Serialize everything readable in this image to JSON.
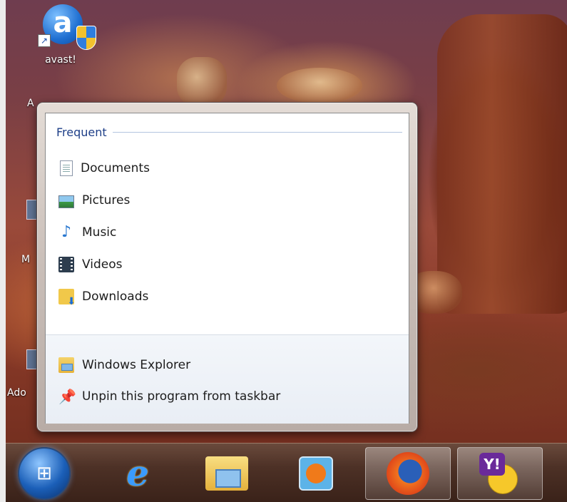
{
  "desktop": {
    "icon_label": "avast!",
    "side_fragments": [
      "A",
      "M",
      "Ado"
    ]
  },
  "jumplist": {
    "section_title": "Frequent",
    "frequent_items": [
      {
        "label": "Documents",
        "icon": "documents-icon"
      },
      {
        "label": "Pictures",
        "icon": "pictures-icon"
      },
      {
        "label": "Music",
        "icon": "music-icon"
      },
      {
        "label": "Videos",
        "icon": "videos-icon"
      },
      {
        "label": "Downloads",
        "icon": "downloads-icon"
      }
    ],
    "tasks": [
      {
        "label": "Windows Explorer",
        "icon": "windows-explorer-icon"
      },
      {
        "label": "Unpin this program from taskbar",
        "icon": "unpin-icon"
      }
    ]
  },
  "taskbar": {
    "buttons": [
      "start-orb-icon",
      "internet-explorer-icon",
      "windows-explorer-icon",
      "windows-media-player-icon",
      "firefox-icon",
      "yahoo-messenger-icon"
    ],
    "active": [
      "firefox-icon",
      "yahoo-messenger-icon"
    ]
  },
  "colors": {
    "section_title": "#1e3f88",
    "taskbar": "#4d3126"
  }
}
